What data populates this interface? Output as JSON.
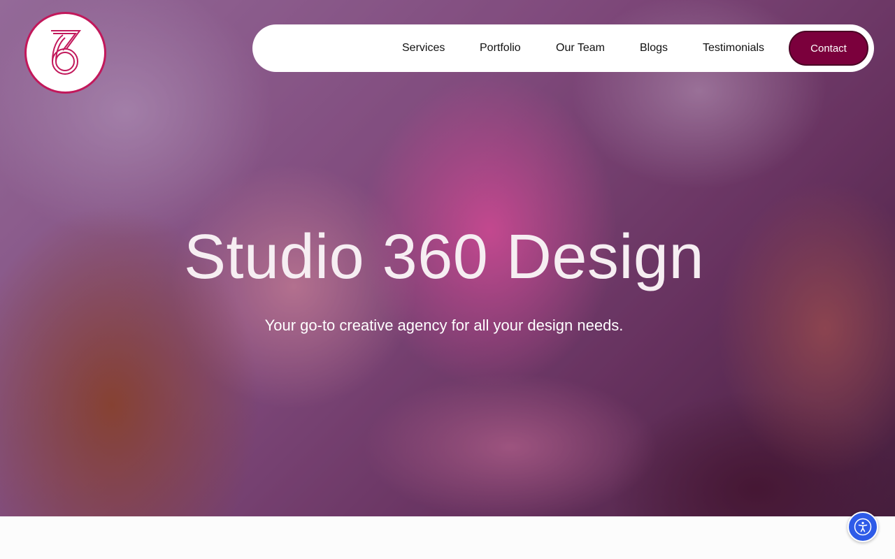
{
  "brand": {
    "logo_icon": "studio-360-logo",
    "accent_color": "#c2185b"
  },
  "nav": {
    "items": [
      {
        "label": "Services"
      },
      {
        "label": "Portfolio"
      },
      {
        "label": "Our Team"
      },
      {
        "label": "Blogs"
      },
      {
        "label": "Testimonials"
      }
    ],
    "contact_label": "Contact",
    "contact_color": "#7b003c"
  },
  "hero": {
    "title": "Studio 360 Design",
    "subtitle": "Your go-to creative agency for all your design needs."
  },
  "accessibility": {
    "icon": "accessibility-icon",
    "color": "#2e5be8"
  }
}
